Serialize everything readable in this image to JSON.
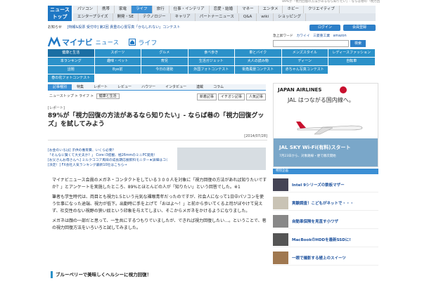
{
  "top_strip": "89%が「視力回復の方法があるなら知りたい」- ならば巷の「視力回復グッズ」を試してみよう",
  "logo": {
    "line1": "ニュース",
    "line2": "トップ"
  },
  "nav": {
    "row1": [
      "パソコン",
      "携帯",
      "家電",
      "ライフ",
      "旅行",
      "仕事・インテリア",
      "恋愛・結婚",
      "マネー",
      "エンタメ",
      "ホビー",
      "クリエイティブ"
    ],
    "row2": [
      "エンタープライズ",
      "開発・SE",
      "テクノロジー",
      "キャリア",
      "パートナーニュース",
      "Q&A",
      "wiki",
      "ショッピング"
    ],
    "active": "ライフ"
  },
  "notice": {
    "label": "お知らせ",
    "link": "[特報&投票 受付中] 第2回 貴重の心霊写真「かもしれない」コンテスト"
  },
  "auth": {
    "login": "ログイン",
    "register": "会員登録"
  },
  "brand": {
    "name": "マイナビ",
    "news": "ニュース",
    "section": "ライフ"
  },
  "search": {
    "label": "急上昇ワード",
    "keywords": [
      "カワイイ",
      "三菱重工業",
      "amazon"
    ],
    "button": "検索"
  },
  "categories": [
    [
      "健康と生活",
      "スポーツ",
      "グルメ",
      "食べ歩き",
      "車とバイク",
      "メンズスタイル",
      "レディースファッション"
    ],
    [
      "本ランキング",
      "趣味・ペット",
      "育児",
      "生活ガジェット",
      "大人の読み物",
      "ディーン",
      "自転車"
    ],
    [
      "話題",
      "Bye前",
      "今日の運勢",
      "外国フォトコンテスト",
      "街角風景コンテスト",
      "赤ちゃん写真コンテスト"
    ],
    [
      "春の花フォトコンテスト"
    ]
  ],
  "subtabs": [
    "記事種別",
    "特集",
    "レポート",
    "レビュー",
    "ハウツー",
    "インタビュー",
    "連載",
    "コラム"
  ],
  "crumbs": {
    "home": "ニューストップ",
    "sep": ">",
    "section": "ライフ",
    "sep2": ">",
    "tag": "健康と生活"
  },
  "sort": [
    "新着記事",
    "イチオシ記事",
    "人気記事"
  ],
  "article": {
    "type": "[レポート]",
    "title": "89%が「視力回復の方法があるなら知りたい」- ならば巷の「視力回復グッズ」を試してみよう",
    "date": "[2014/07/28]",
    "related": [
      "[お金のいろは] 子供の養育費、いくら必要？",
      "「そんなに賢くて大丈夫か？」 Core i3搭載、極26mmのミニPC発売！",
      "[お父さんお母さんへ] ミルクココア風味の成長期応援飲料モニター★詳細はコチラ☆",
      "[決定！] FX会社人気ランキング最新10社はこちら→"
    ],
    "paragraphs": [
      "マイナビニュース会員のメガネ・コンタクトをしている３００人を対象に「視力回復の方法があれば知りたいですか？」とアンケートを実施したところ、89%とほとんどの人が「知りたい」という回答でした。※1",
      "筆者も学生時代は、両目とも視力1.5という元気な裸眼青年だったのですが、社会人になって1日中パソコンを使う仕事になった途端、視力が低下。出勤時に手を上げて「おはよ～！」と前から歩いてくる上司がぼやけて見えず、社交性のない視野の狭い奴という印象を与えてしまい、そこからメガネをかけるようになりました。",
      "メガネは顔の一部だと思って、一生共にするつもりでいましたが、できれば視力回復したい…。ということで、巷の視力回復方法をいろいろと試してみました。"
    ],
    "subhead": "ブルーベリーで美味しくヘルシーに視力回復！"
  },
  "jal_ad": {
    "brand": "JAPAN AIRLINES",
    "copy": "JAL はつながる国内線へ。",
    "sky_title": "JAL SKY Wi-Fi(有料)スタート",
    "sky_sub": "7月23日から、対象路線・便で順次開始"
  },
  "tech": {
    "header": "特別企画",
    "items": [
      "Intel 9シリーズの鉄板マザー",
      "実験調査！こどもがネットで・・・",
      "自動車保険を見直す小ワザ",
      "MacBookのHDDを最新SSDに!",
      "一眼で撮影する極上のスイーツ"
    ]
  },
  "colors": {
    "brand_blue": "#1e77c4",
    "category_blue": "#2b91c9",
    "jal_red": "#c8102e"
  }
}
